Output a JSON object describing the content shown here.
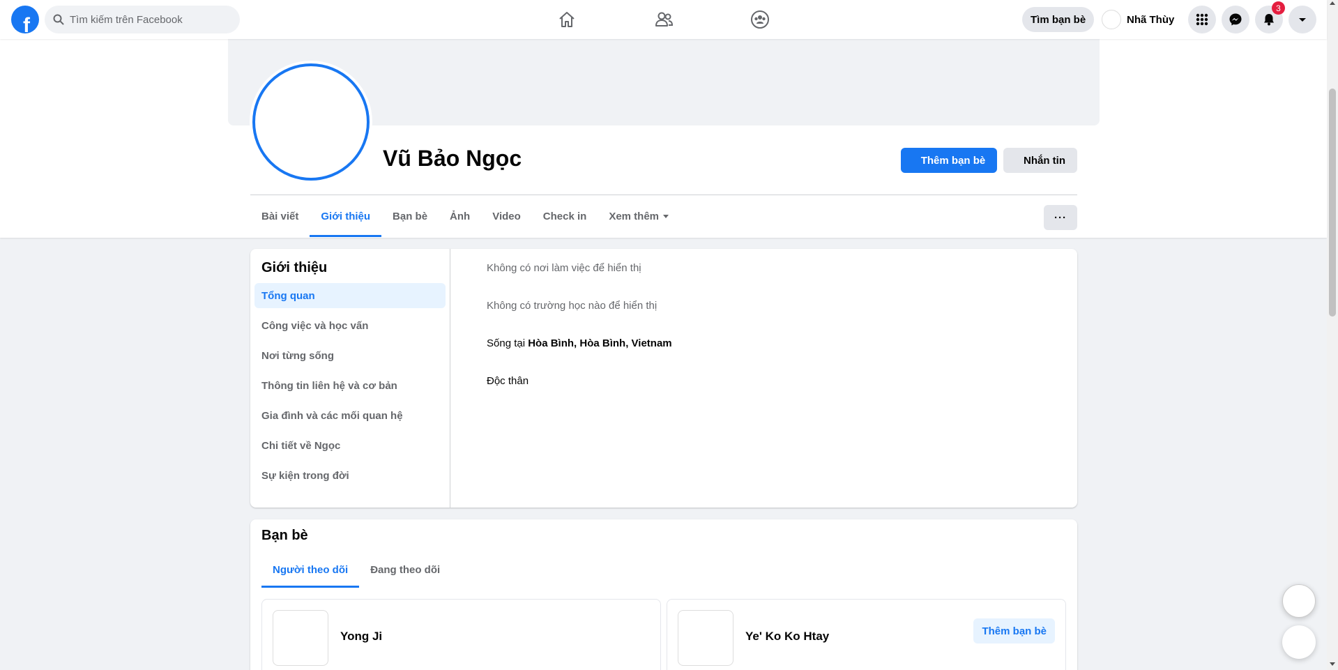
{
  "topbar": {
    "logo_letter": "f",
    "search_placeholder": "Tìm kiếm trên Facebook",
    "find_friends_label": "Tìm bạn bè",
    "user_name": "Nhã Thùy",
    "notification_count": "3",
    "nav_icons": [
      "home-icon",
      "friends-icon",
      "groups-icon"
    ],
    "action_icons": [
      "menu-grid-icon",
      "messenger-icon",
      "bell-icon",
      "caret-down-icon"
    ]
  },
  "profile": {
    "name": "Vũ Bảo Ngọc",
    "add_friend_label": "Thêm bạn bè",
    "message_label": "Nhắn tin",
    "more_label": "···",
    "tabs": [
      {
        "label": "Bài viết"
      },
      {
        "label": "Giới thiệu"
      },
      {
        "label": "Bạn bè"
      },
      {
        "label": "Ảnh"
      },
      {
        "label": "Video"
      },
      {
        "label": "Check in"
      },
      {
        "label": "Xem thêm"
      }
    ],
    "active_tab": "Giới thiệu"
  },
  "intro": {
    "title": "Giới thiệu",
    "menu": [
      {
        "label": "Tổng quan"
      },
      {
        "label": "Công việc và học vấn"
      },
      {
        "label": "Nơi từng sống"
      },
      {
        "label": "Thông tin liên hệ và cơ bản"
      },
      {
        "label": "Gia đình và các mối quan hệ"
      },
      {
        "label": "Chi tiết về Ngọc"
      },
      {
        "label": "Sự kiện trong đời"
      }
    ],
    "workplace_empty": "Không có nơi làm việc để hiển thị",
    "school_empty": "Không có trường học nào để hiển thị",
    "lives_in_prefix": "Sống tại ",
    "lives_in_place": "Hòa Bình, Hòa Bình, Vietnam",
    "relationship": "Độc thân"
  },
  "friends": {
    "title": "Bạn bè",
    "tabs": [
      {
        "label": "Người theo dõi"
      },
      {
        "label": "Đang theo dõi"
      }
    ],
    "list": [
      {
        "name": "Yong Ji"
      },
      {
        "name": "Ye' Ko Ko Htay",
        "action": "Thêm bạn bè"
      }
    ]
  },
  "colors": {
    "accent": "#1877f2",
    "background": "#f0f2f5",
    "badge": "#e41e3f"
  }
}
